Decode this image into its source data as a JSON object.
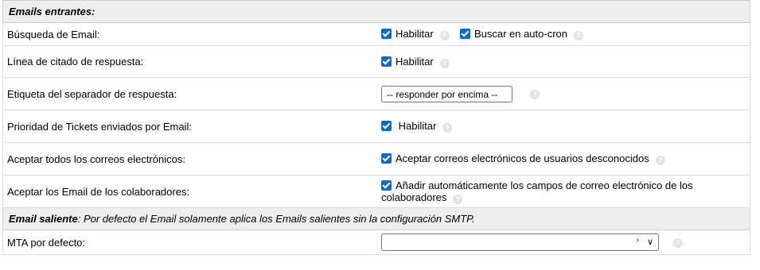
{
  "incoming": {
    "header": "Emails entrantes:",
    "rows": {
      "search": {
        "label": "Búsqueda de Email:",
        "enable": "Habilitar",
        "autocron": "Buscar en auto-cron"
      },
      "quote": {
        "label": "Línea de citado de respuesta:",
        "enable": "Habilitar"
      },
      "separator": {
        "label": "Etiqueta del separador de respuesta:",
        "value": "-- responder por encima --"
      },
      "priority": {
        "label": "Prioridad de Tickets enviados por Email:",
        "enable": "Habilitar"
      },
      "accept_all": {
        "label": "Aceptar todos los correos electrónicos:",
        "text": "Aceptar correos electrónicos de usuarios desconocidos"
      },
      "collaborators": {
        "label": "Aceptar los Email de los colaboradores:",
        "text": "Añadir automáticamente los campos de correo electrónico de los colaboradores"
      }
    }
  },
  "outgoing": {
    "title": "Email saliente",
    "note": ": Por defecto el Email solamente aplica los Emails salientes sin la configuración SMTP.",
    "mta": {
      "label": "MTA por defecto:",
      "value": ""
    }
  },
  "icons": {
    "checkbox": "checkbox-checked-icon",
    "help": "help-icon",
    "dropdown": "chevron-down-icon"
  },
  "colors": {
    "checkbox": "#0a6ccf",
    "header_bg": "#eeeeee",
    "help": "#e3e3e3"
  }
}
